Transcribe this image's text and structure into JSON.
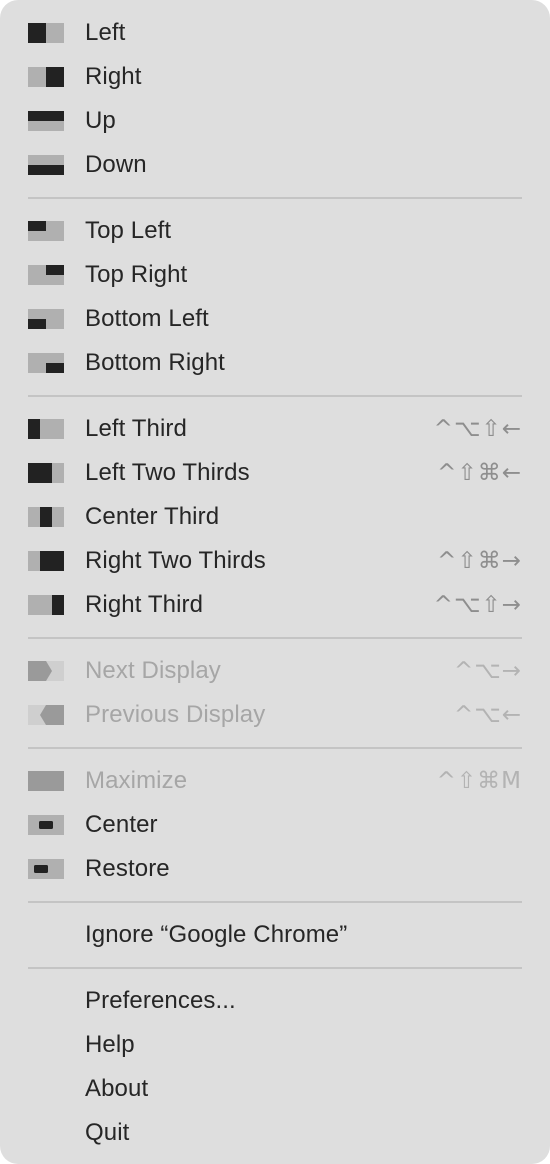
{
  "colors": {
    "background": "#dedede",
    "icon_dark": "#222222",
    "icon_light": "#b0b0b0",
    "disabled_text": "#a6a6a6",
    "separator": "#c4c4c4"
  },
  "menu": {
    "group1": [
      {
        "label": "Left",
        "shortcut": "",
        "icon": "left-half-icon"
      },
      {
        "label": "Right",
        "shortcut": "",
        "icon": "right-half-icon"
      },
      {
        "label": "Up",
        "shortcut": "",
        "icon": "top-half-icon"
      },
      {
        "label": "Down",
        "shortcut": "",
        "icon": "bottom-half-icon"
      }
    ],
    "group2": [
      {
        "label": "Top Left",
        "shortcut": "",
        "icon": "top-left-icon"
      },
      {
        "label": "Top Right",
        "shortcut": "",
        "icon": "top-right-icon"
      },
      {
        "label": "Bottom Left",
        "shortcut": "",
        "icon": "bottom-left-icon"
      },
      {
        "label": "Bottom Right",
        "shortcut": "",
        "icon": "bottom-right-icon"
      }
    ],
    "group3": [
      {
        "label": "Left Third",
        "shortcut": "^⌥⇧←",
        "icon": "left-third-icon"
      },
      {
        "label": "Left Two Thirds",
        "shortcut": "^⇧⌘←",
        "icon": "left-two-thirds-icon"
      },
      {
        "label": "Center Third",
        "shortcut": "",
        "icon": "center-third-icon"
      },
      {
        "label": "Right Two Thirds",
        "shortcut": "^⇧⌘→",
        "icon": "right-two-thirds-icon"
      },
      {
        "label": "Right Third",
        "shortcut": "^⌥⇧→",
        "icon": "right-third-icon"
      }
    ],
    "group4": [
      {
        "label": "Next Display",
        "shortcut": "^⌥→",
        "icon": "next-display-icon",
        "disabled": true
      },
      {
        "label": "Previous Display",
        "shortcut": "^⌥←",
        "icon": "previous-display-icon",
        "disabled": true
      }
    ],
    "group5": [
      {
        "label": "Maximize",
        "shortcut": "^⇧⌘M",
        "icon": "maximize-icon",
        "disabled": true
      },
      {
        "label": "Center",
        "shortcut": "",
        "icon": "center-icon"
      },
      {
        "label": "Restore",
        "shortcut": "",
        "icon": "restore-icon"
      }
    ],
    "group6": [
      {
        "label": "Ignore “Google Chrome”"
      }
    ],
    "group7": [
      {
        "label": "Preferences..."
      },
      {
        "label": "Help"
      },
      {
        "label": "About"
      },
      {
        "label": "Quit"
      }
    ]
  }
}
